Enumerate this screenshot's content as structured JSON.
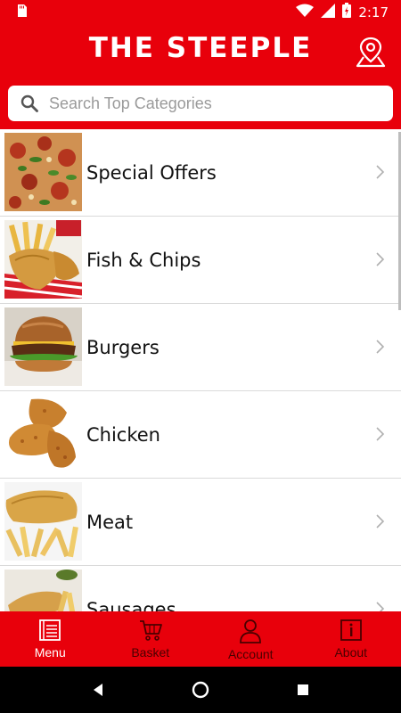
{
  "status_bar": {
    "time": "2:17",
    "icons": [
      "sd-card-icon",
      "wifi-icon",
      "cell-signal-icon",
      "battery-icon"
    ]
  },
  "header": {
    "title": "THE STEEPLE",
    "location_icon": "map-pin-icon"
  },
  "search": {
    "placeholder": "Search Top Categories",
    "icon": "search-icon"
  },
  "categories": [
    {
      "label": "Special Offers",
      "image": "pizza"
    },
    {
      "label": "Fish & Chips",
      "image": "fish-and-chips"
    },
    {
      "label": "Burgers",
      "image": "burger"
    },
    {
      "label": "Chicken",
      "image": "fried-chicken"
    },
    {
      "label": "Meat",
      "image": "battered-fish"
    },
    {
      "label": "Sausages",
      "image": "sausage"
    }
  ],
  "bottom_nav": {
    "items": [
      {
        "label": "Menu",
        "icon": "menu-book-icon",
        "active": true
      },
      {
        "label": "Basket",
        "icon": "cart-icon",
        "active": false
      },
      {
        "label": "Account",
        "icon": "person-icon",
        "active": false
      },
      {
        "label": "About",
        "icon": "info-icon",
        "active": false
      }
    ]
  },
  "colors": {
    "brand_red": "#e8000b",
    "inactive_nav": "#4a0000"
  }
}
